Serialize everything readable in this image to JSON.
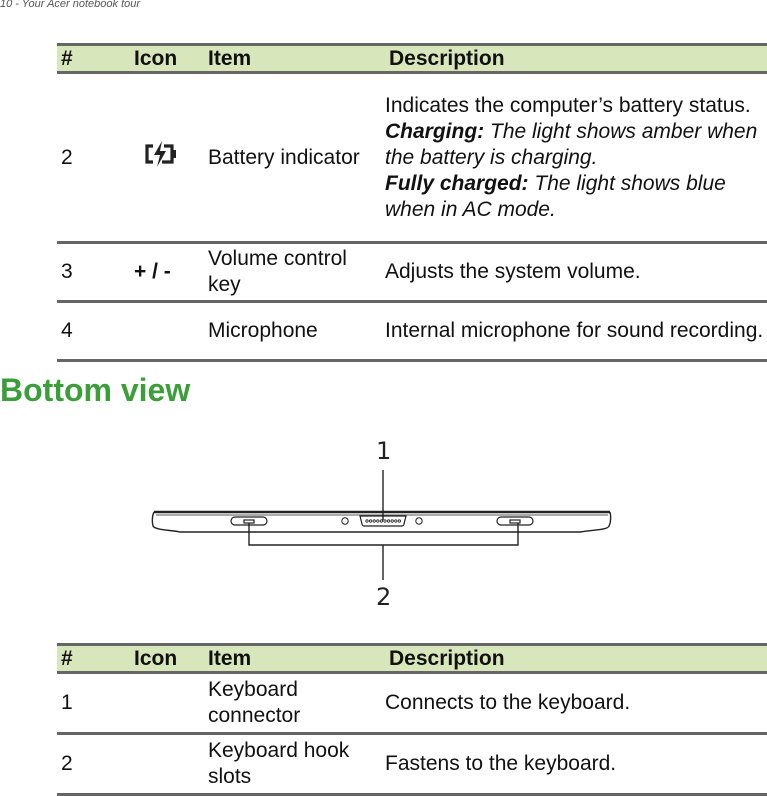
{
  "page": {
    "running_head": "10 - Your Acer notebook tour"
  },
  "table1": {
    "headers": {
      "num": "#",
      "icon": "Icon",
      "item": "Item",
      "description": "Description"
    },
    "rows": [
      {
        "num": "2",
        "icon": "battery-charging-icon",
        "item": "Battery indicator",
        "description": "Indicates the computer’s battery status.",
        "notes": [
          {
            "label": "Charging:",
            "text": " The light shows amber when the battery is charging."
          },
          {
            "label": "Fully charged:",
            "text": " The light shows blue when in AC mode."
          }
        ]
      },
      {
        "num": "3",
        "icon_text": "+ / -",
        "item": "Volume control key",
        "description": "Adjusts the system volume."
      },
      {
        "num": "4",
        "icon_text": "",
        "item": "Microphone",
        "description": "Internal microphone for sound recording."
      }
    ]
  },
  "section": {
    "title": "Bottom view",
    "title_color": "#3b9e3a"
  },
  "diagram": {
    "callouts": [
      "1",
      "2"
    ]
  },
  "table2": {
    "headers": {
      "num": "#",
      "icon": "Icon",
      "item": "Item",
      "description": "Description"
    },
    "rows": [
      {
        "num": "1",
        "icon_text": "",
        "item": "Keyboard connector",
        "description": "Connects to the keyboard."
      },
      {
        "num": "2",
        "icon_text": "",
        "item": "Keyboard hook slots",
        "description": "Fastens to the keyboard."
      }
    ]
  },
  "colors": {
    "header_bg": "#d8e6bb",
    "rule": "#666666"
  }
}
